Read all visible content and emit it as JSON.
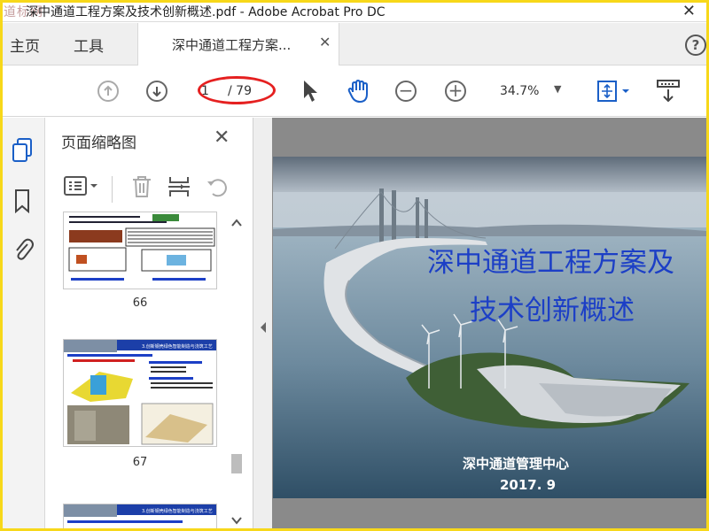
{
  "window": {
    "title": "深中通道工程方案及技术创新概述.pdf - Adobe Acrobat Pro DC",
    "watermark": "道标网",
    "close_glyph": "✕"
  },
  "menubar": {
    "home": "主页",
    "tools": "工具",
    "tab_label": "深中通道工程方案...",
    "tab_close": "✕",
    "help": "?"
  },
  "toolbar": {
    "page_current": "1",
    "page_total": "/ 79",
    "zoom": "34.7%",
    "highlight_color": "#e52020"
  },
  "panel": {
    "title": "页面缩略图",
    "close": "✕",
    "thumbnails": [
      {
        "label": "66"
      },
      {
        "label": "67",
        "heading": "3.创新钢壳绿色智能制造与浇筑工艺"
      },
      {
        "label": "",
        "heading": "3.创新钢壳绿色智能制造与浇筑工艺"
      }
    ]
  },
  "document": {
    "title_line1": "深中通道工程方案及",
    "title_line2": "技术创新概述",
    "organization": "深中通道管理中心",
    "date": "2017. 9",
    "title_color": "#1c3fc6"
  },
  "icons": [
    "up-arrow-icon",
    "down-arrow-icon",
    "select-cursor-icon",
    "hand-icon",
    "zoom-out-icon",
    "zoom-in-icon",
    "fit-page-icon",
    "read-mode-icon",
    "thumbnails-icon",
    "bookmark-icon",
    "attachment-icon",
    "options-icon",
    "delete-icon",
    "insert-page-icon",
    "rotate-icon",
    "collapse-arrow-icon"
  ]
}
